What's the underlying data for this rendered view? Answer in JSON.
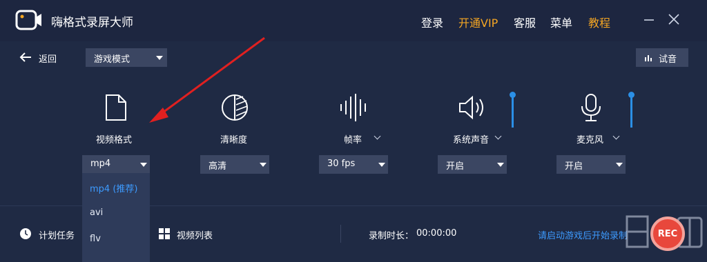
{
  "window": {
    "title": "嗨格式录屏大师",
    "nav": [
      {
        "label": "登录",
        "accent": false
      },
      {
        "label": "开通VIP",
        "accent": true
      },
      {
        "label": "客服",
        "accent": false
      },
      {
        "label": "菜单",
        "accent": false
      },
      {
        "label": "教程",
        "accent": true
      }
    ]
  },
  "toolbar": {
    "back_label": "返回",
    "mode_value": "游戏模式",
    "audition_label": "试音"
  },
  "settings": {
    "video_format": {
      "label": "视频格式",
      "value": "mp4",
      "icon": "file-icon"
    },
    "clarity": {
      "label": "清晰度",
      "value": "高清",
      "icon": "contrast-icon"
    },
    "frame_rate": {
      "label": "帧率",
      "value": "30 fps",
      "icon": "waveform-icon"
    },
    "system_sound": {
      "label": "系统声音",
      "value": "开启",
      "icon": "speaker-icon",
      "volume_fraction": 1.0
    },
    "microphone": {
      "label": "麦克风",
      "value": "开启",
      "icon": "microphone-icon",
      "volume_fraction": 1.0
    }
  },
  "format_dropdown": {
    "options": [
      "mp4 (推荐)",
      "avi",
      "flv"
    ],
    "selected_index": 0
  },
  "bottom": {
    "schedule_label": "计划任务",
    "video_list_label": "视频列表",
    "duration_label": "录制时长：",
    "duration_value": "00:00:00",
    "hint": "请启动游戏后开始录制",
    "rec_label": "REC"
  },
  "colors": {
    "background": "#1f2a44",
    "accent_orange": "#f5a623",
    "link_blue": "#3d9bff",
    "rec_red": "#e8473c"
  }
}
